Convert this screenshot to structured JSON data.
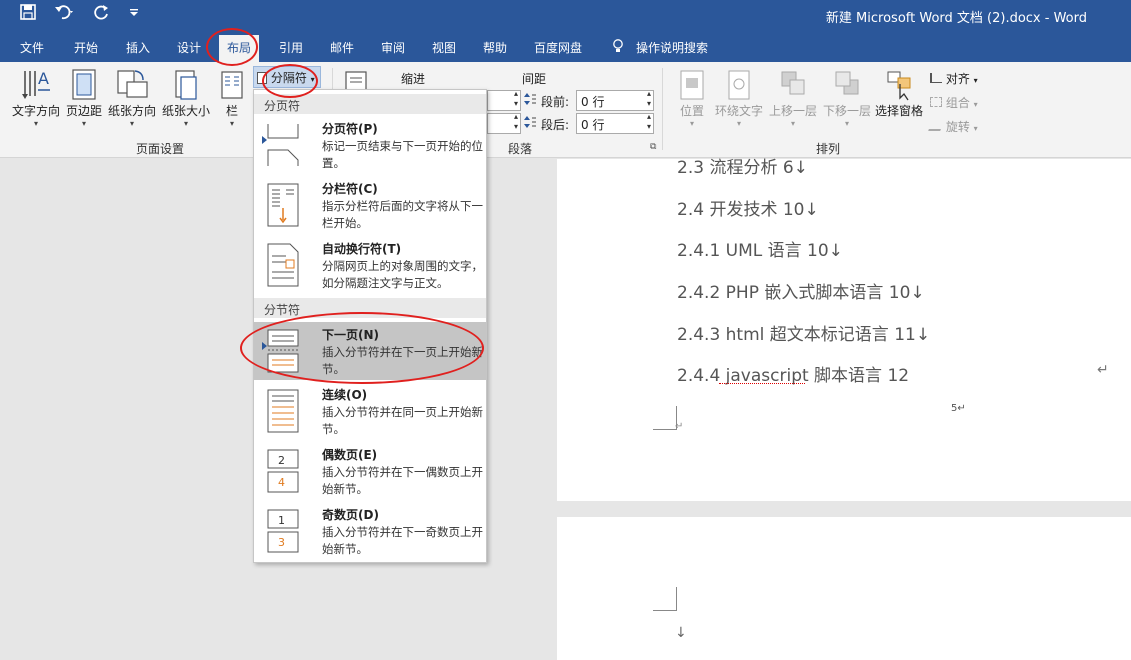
{
  "window": {
    "title": "新建 Microsoft Word 文档 (2).docx  -  Word",
    "qat_icons": [
      "save-icon",
      "undo-icon",
      "redo-icon",
      "customize-icon"
    ]
  },
  "tabs": [
    "文件",
    "开始",
    "插入",
    "设计",
    "布局",
    "引用",
    "邮件",
    "审阅",
    "视图",
    "帮助",
    "百度网盘",
    "操作说明搜索"
  ],
  "active_tab": "布局",
  "ribbon": {
    "page_setup": {
      "label": "页面设置",
      "buttons": [
        "文字方向",
        "页边距",
        "纸张方向",
        "纸张大小",
        "栏"
      ],
      "breaks_button": "分隔符"
    },
    "paragraph": {
      "label": "段落",
      "indent_label": "缩进",
      "spacing_label": "间距",
      "before_label": "段前:",
      "before_value": "0 行",
      "after_label": "段后:",
      "after_value": "0 行"
    },
    "arrange": {
      "label": "排列",
      "buttons": [
        "位置",
        "环绕文字",
        "上移一层",
        "下移一层",
        "选择窗格"
      ],
      "small": [
        "对齐",
        "组合",
        "旋转"
      ]
    }
  },
  "menu": {
    "section_page": "分页符",
    "section_section": "分节符",
    "items": [
      {
        "title": "分页符(P)",
        "desc": "标记一页结束与下一页开始的位置。"
      },
      {
        "title": "分栏符(C)",
        "desc": "指示分栏符后面的文字将从下一栏开始。"
      },
      {
        "title": "自动换行符(T)",
        "desc": "分隔网页上的对象周围的文字，如分隔题注文字与正文。"
      },
      {
        "title": "下一页(N)",
        "desc": "插入分节符并在下一页上开始新节。"
      },
      {
        "title": "连续(O)",
        "desc": "插入分节符并在同一页上开始新节。"
      },
      {
        "title": "偶数页(E)",
        "desc": "插入分节符并在下一偶数页上开始新节。"
      },
      {
        "title": "奇数页(D)",
        "desc": "插入分节符并在下一奇数页上开始新节。"
      }
    ],
    "highlighted": "下一页(N)"
  },
  "document": {
    "toc": [
      "2.3 流程分析 6↓",
      "2.4 开发技术 10↓",
      "2.4.1 UML 语言 10↓",
      "2.4.2 PHP 嵌入式脚本语言 10↓",
      "2.4.3 html 超文本标记语言 11↓",
      "2.4.4 javascript 脚本语言 12"
    ],
    "return_mark": "↵",
    "page_number": "5↵",
    "small_return": "↵",
    "down_arrow": "↓"
  }
}
